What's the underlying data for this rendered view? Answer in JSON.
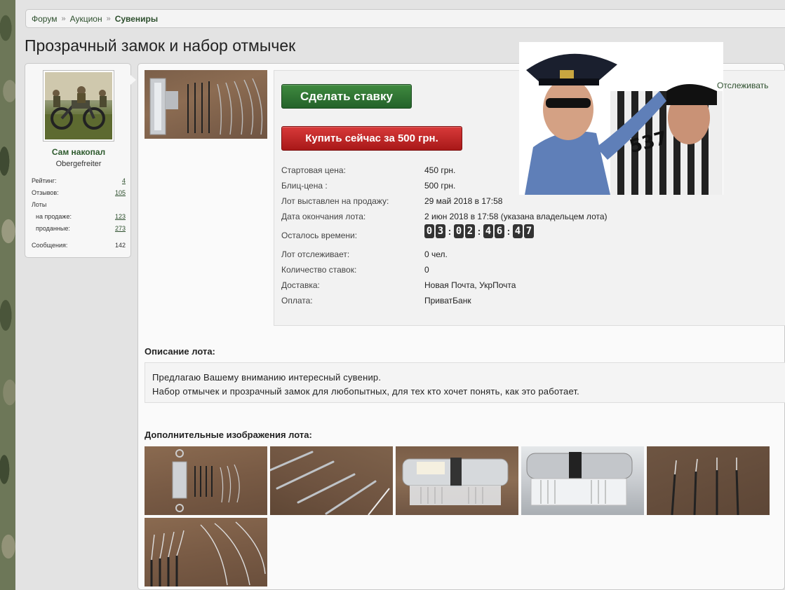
{
  "breadcrumb": {
    "items": [
      "Форум",
      "Аукцион"
    ],
    "current": "Сувениры",
    "separator": "»"
  },
  "page_title": "Прозрачный замок и набор отмычек",
  "user": {
    "name": "Сам накопал",
    "title": "Obergefreiter",
    "stats": [
      {
        "label": "Рейтинг:",
        "value": "4"
      },
      {
        "label": "Отзывов:",
        "value": "105"
      },
      {
        "label": "Лоты",
        "value": ""
      },
      {
        "label": "на продаже:",
        "value": "123"
      },
      {
        "label": "проданные:",
        "value": "273"
      },
      {
        "label": "Сообщения:",
        "value": "142"
      }
    ]
  },
  "actions": {
    "bid_label": "Сделать ставку",
    "buy_label": "Купить сейчас за 500 грн.",
    "follow_label": "Отслеживать"
  },
  "details": {
    "start_price": {
      "label": "Стартовая цена:",
      "value": "450 грн."
    },
    "blitz_price": {
      "label": "Блиц-цена :",
      "value": "500 грн."
    },
    "listed": {
      "label": "Лот выставлен на продажу:",
      "value": "29 май 2018 в 17:58"
    },
    "end_date": {
      "label": "Дата окончания лота:",
      "value": "2 июн 2018 в 17:58 (указана владельцем лота)"
    },
    "time_left": {
      "label": "Осталось времени:",
      "digits": [
        "0",
        "3",
        "0",
        "2",
        "4",
        "6",
        "4",
        "7"
      ]
    },
    "watchers": {
      "label": "Лот отслеживает:",
      "value": "0 чел."
    },
    "bids": {
      "label": "Количество ставок:",
      "value": "0"
    },
    "delivery": {
      "label": "Доставка:",
      "value": "Новая Почта, УкрПочта"
    },
    "payment": {
      "label": "Оплата:",
      "value": "ПриватБанк"
    }
  },
  "description": {
    "title": "Описание лота:",
    "lines": [
      "Предлагаю Вашему вниманию интересный сувенир.",
      "Набор отмычек и прозрачный замок для любопытных, для тех кто хочет понять, как это работает."
    ]
  },
  "gallery": {
    "title": "Дополнительные изображения лота:"
  },
  "colors": {
    "accent_green": "#2d4f2d",
    "bid_button": "#2e7033",
    "buy_button": "#c02626"
  }
}
